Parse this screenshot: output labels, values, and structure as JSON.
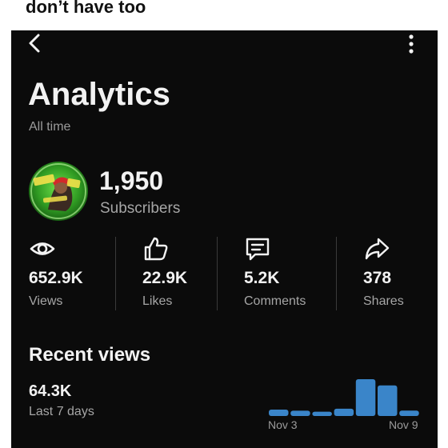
{
  "caption": "don’t have too",
  "header": {
    "title": "Analytics",
    "subtitle": "All time"
  },
  "channel": {
    "subscriber_count": "1,950",
    "subscriber_label": "Subscribers"
  },
  "stats": [
    {
      "icon": "eye-icon",
      "value": "652.9K",
      "label": "Views"
    },
    {
      "icon": "thumbs-up-icon",
      "value": "22.9K",
      "label": "Likes"
    },
    {
      "icon": "comment-icon",
      "value": "5.2K",
      "label": "Comments"
    },
    {
      "icon": "share-icon",
      "value": "378",
      "label": "Shares"
    }
  ],
  "recent": {
    "title": "Recent views",
    "value": "64.3K",
    "period": "Last 7 days",
    "x_start_label": "Nov 3",
    "x_end_label": "Nov 9"
  },
  "chart_data": {
    "type": "bar",
    "categories": [
      "Nov 3",
      "Nov 4",
      "Nov 5",
      "Nov 6",
      "Nov 7",
      "Nov 8",
      "Nov 9"
    ],
    "values": [
      3.9,
      3.2,
      2.6,
      4.4,
      22.3,
      18.5,
      3.3
    ],
    "xlabel": "",
    "ylabel": "",
    "bar_color": "#3a85c9"
  },
  "colors": {
    "background": "#0b0b0b",
    "text": "#f2f2f2",
    "muted": "#a6a6a6",
    "accent": "#3a85c9"
  }
}
